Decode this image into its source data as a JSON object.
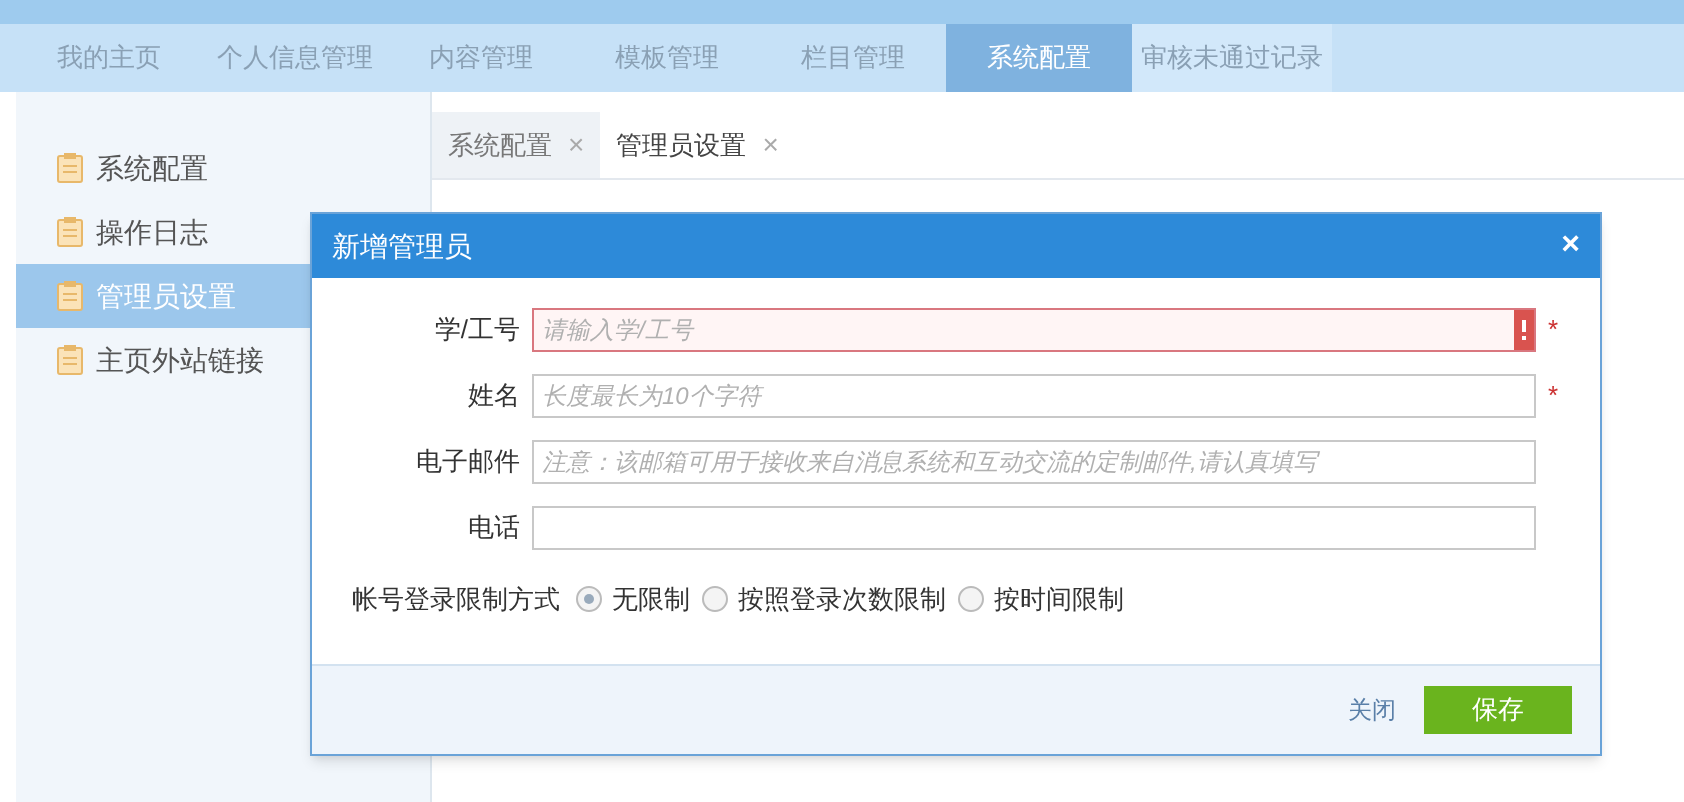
{
  "nav": [
    {
      "label": "我的主页",
      "selected": false
    },
    {
      "label": "个人信息管理",
      "selected": false
    },
    {
      "label": "内容管理",
      "selected": false
    },
    {
      "label": "模板管理",
      "selected": false
    },
    {
      "label": "栏目管理",
      "selected": false
    },
    {
      "label": "系统配置",
      "selected": true
    },
    {
      "label": "审核未通过记录",
      "selected": false
    }
  ],
  "sidebar": {
    "items": [
      {
        "label": "系统配置",
        "selected": false
      },
      {
        "label": "操作日志",
        "selected": false
      },
      {
        "label": "管理员设置",
        "selected": true
      },
      {
        "label": "主页外站链接",
        "selected": false
      }
    ]
  },
  "tabs": [
    {
      "label": "系统配置",
      "close": "×",
      "selected": false
    },
    {
      "label": "管理员设置",
      "close": "×",
      "selected": true
    }
  ],
  "dialog": {
    "title": "新增管理员",
    "close": "×",
    "fields": [
      {
        "label": "学/工号",
        "placeholder": "请输入学/工号",
        "required": "*",
        "error": true
      },
      {
        "label": "姓名",
        "placeholder": "长度最长为10个字符",
        "required": "*",
        "error": false
      },
      {
        "label": "电子邮件",
        "placeholder": "注意：该邮箱可用于接收来自消息系统和互动交流的定制邮件,请认真填写",
        "error": false
      },
      {
        "label": "电话",
        "error": false
      }
    ],
    "limit": {
      "label": "帐号登录限制方式",
      "options": [
        {
          "label": "无限制",
          "selected": true
        },
        {
          "label": "按照登录次数限制",
          "selected": false
        },
        {
          "label": "按时间限制",
          "selected": false
        }
      ]
    },
    "buttons": {
      "close": "关闭",
      "save": "保存"
    }
  }
}
